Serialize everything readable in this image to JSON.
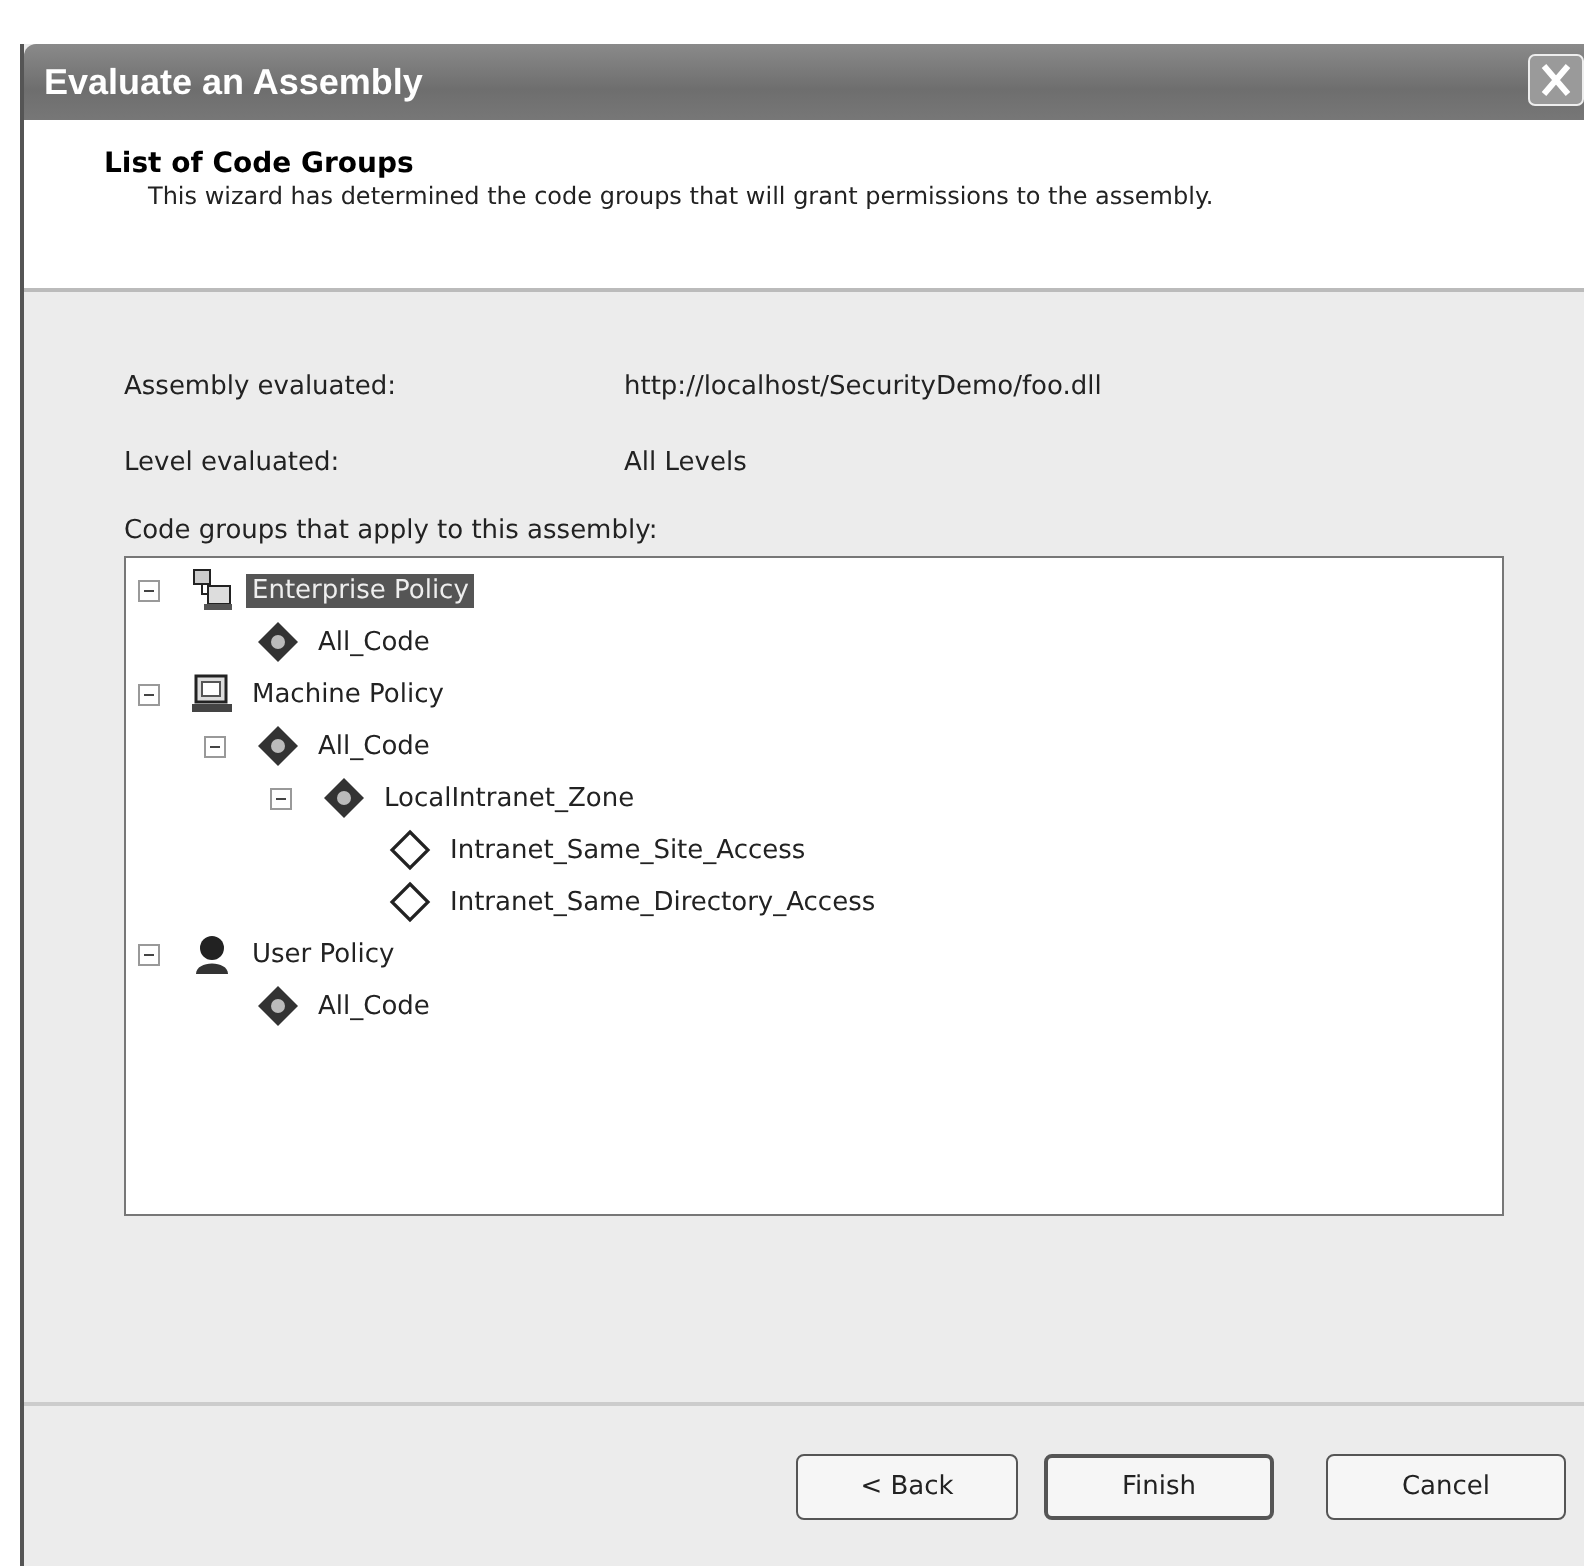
{
  "window": {
    "title": "Evaluate an Assembly"
  },
  "header": {
    "title": "List of Code Groups",
    "description": "This wizard has determined the code groups that will grant permissions to the assembly."
  },
  "fields": [
    {
      "label": "Assembly evaluated:",
      "value": "http://localhost/SecurityDemo/foo.dll"
    },
    {
      "label": "Level evaluated:",
      "value": "All Levels"
    }
  ],
  "tree": {
    "label": "Code groups that apply to this assembly:",
    "items": [
      {
        "label": "Enterprise Policy",
        "kind": "enterprise",
        "expanded": true,
        "selected": true,
        "children": [
          {
            "label": "All_Code",
            "kind": "group",
            "selected": false
          }
        ]
      },
      {
        "label": "Machine Policy",
        "kind": "machine",
        "expanded": true,
        "selected": false,
        "children": [
          {
            "label": "All_Code",
            "kind": "group",
            "expanded": true,
            "selected": false,
            "children": [
              {
                "label": "LocalIntranet_Zone",
                "kind": "group",
                "expanded": true,
                "selected": false,
                "children": [
                  {
                    "label": "Intranet_Same_Site_Access",
                    "kind": "leaf",
                    "selected": false
                  },
                  {
                    "label": "Intranet_Same_Directory_Access",
                    "kind": "leaf",
                    "selected": false
                  }
                ]
              }
            ]
          }
        ]
      },
      {
        "label": "User Policy",
        "kind": "user",
        "expanded": true,
        "selected": false,
        "children": [
          {
            "label": "All_Code",
            "kind": "group",
            "selected": false
          }
        ]
      }
    ]
  },
  "buttons": [
    {
      "label": "< Back"
    },
    {
      "label": "Finish"
    },
    {
      "label": "Cancel"
    }
  ]
}
